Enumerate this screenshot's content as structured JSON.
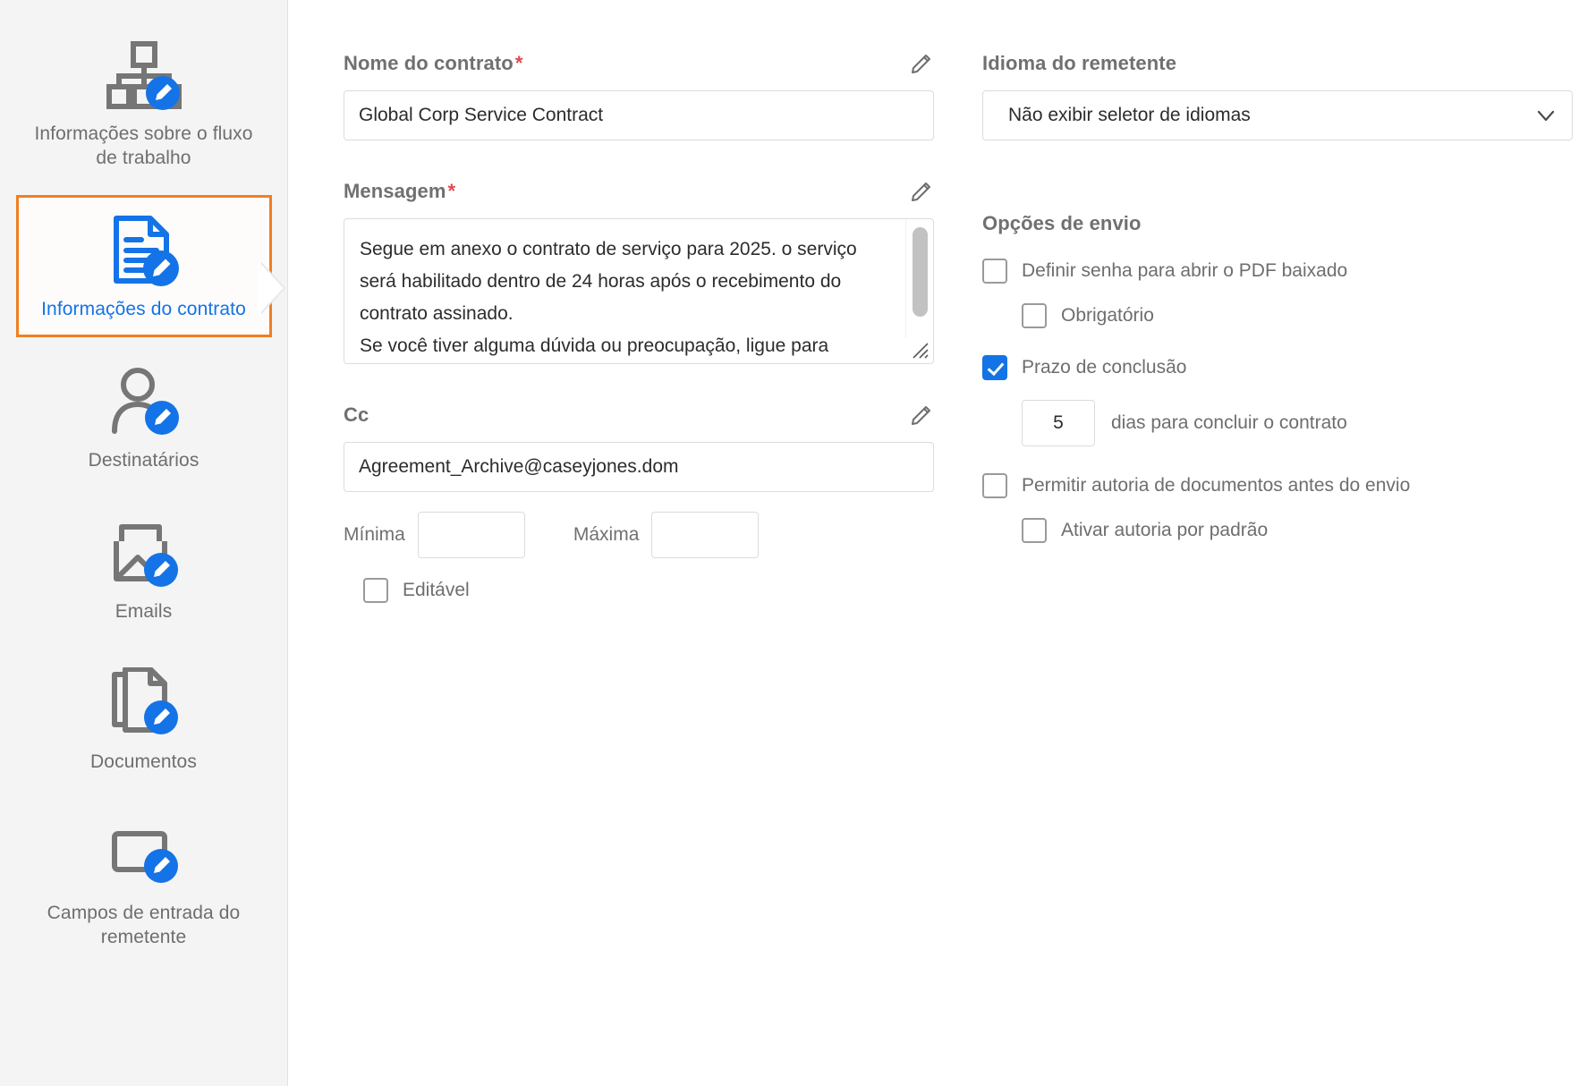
{
  "sidebar": {
    "items": [
      {
        "id": "workflow-info",
        "label": "Informações sobre o\nfluxo de trabalho",
        "icon": "workflow-edit-icon",
        "selected": false
      },
      {
        "id": "contract-info",
        "label": "Informações do contrato",
        "icon": "document-edit-icon",
        "selected": true
      },
      {
        "id": "recipients",
        "label": "Destinatários",
        "icon": "user-edit-icon",
        "selected": false
      },
      {
        "id": "emails",
        "label": "Emails",
        "icon": "mail-image-edit-icon",
        "selected": false
      },
      {
        "id": "documents",
        "label": "Documentos",
        "icon": "documents-edit-icon",
        "selected": false
      },
      {
        "id": "sender-input-fields",
        "label": "Campos de entrada do\nremetente",
        "icon": "input-field-edit-icon",
        "selected": false
      }
    ]
  },
  "form": {
    "contract_name": {
      "label": "Nome do contrato",
      "required_mark": "*",
      "value": "Global Corp Service Contract",
      "placeholder": ""
    },
    "message": {
      "label": "Mensagem",
      "required_mark": "*",
      "value": "Segue em anexo o contrato de serviço para 2025. o serviço será habilitado dentro de 24 horas após o recebimento do contrato assinado.\nSe você tiver alguma dúvida ou preocupação, ligue para",
      "placeholder": ""
    },
    "cc": {
      "label": "Cc",
      "value": "Agreement_Archive@caseyjones.dom",
      "placeholder": "",
      "minimum_label": "Mínima",
      "minimum_value": "",
      "maximum_label": "Máxima",
      "maximum_value": "",
      "editable_label": "Editável",
      "editable_checked": false
    }
  },
  "sender_language": {
    "label": "Idioma do remetente",
    "selected": "Não exibir seletor de idiomas"
  },
  "send_options": {
    "title": "Opções de envio",
    "options": [
      {
        "id": "set-password",
        "label": "Definir senha para abrir o PDF baixado",
        "checked": false,
        "indent": false
      },
      {
        "id": "mandatory",
        "label": "Obrigatório",
        "checked": false,
        "indent": true
      },
      {
        "id": "completion-deadline",
        "label": "Prazo de conclusão",
        "checked": true,
        "indent": false
      },
      {
        "id": "allow-authoring",
        "label": "Permitir autoria de documentos antes do envio",
        "checked": false,
        "indent": false
      },
      {
        "id": "enable-authoring-default",
        "label": "Ativar autoria por padrão",
        "checked": false,
        "indent": true
      }
    ],
    "deadline_days_value": "5",
    "deadline_days_text": "dias para concluir o contrato"
  },
  "colors": {
    "accent_blue": "#1473e6",
    "selected_orange": "#f07f22",
    "required_red": "#e34850",
    "label_gray": "#707070",
    "icon_gray": "#767676",
    "sidebar_bg": "#f4f4f4"
  }
}
